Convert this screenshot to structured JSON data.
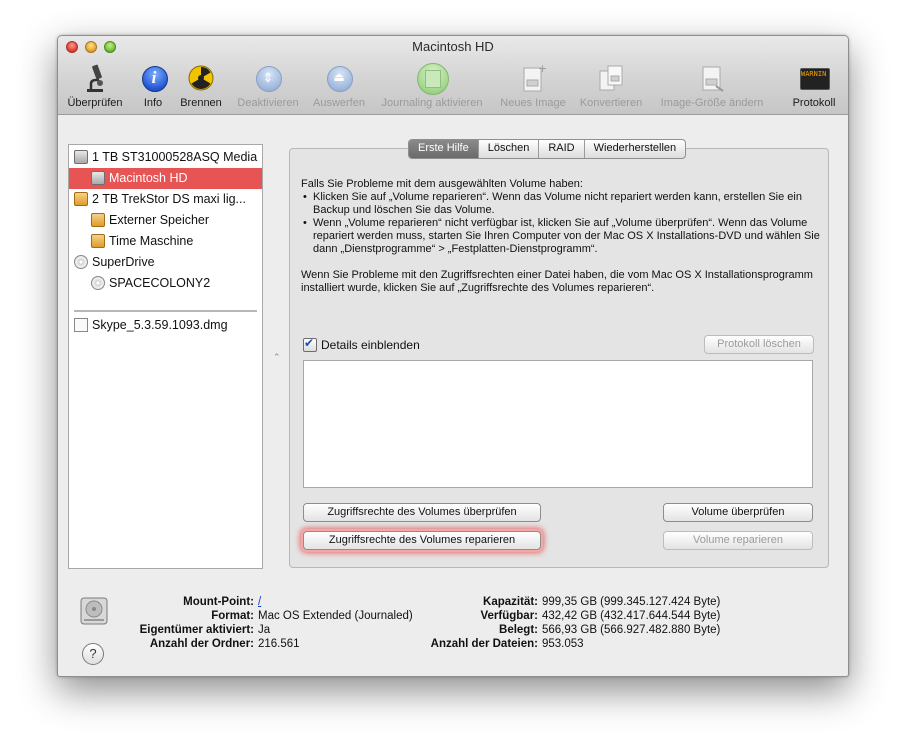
{
  "window": {
    "title": "Macintosh HD"
  },
  "toolbar": {
    "items": [
      {
        "label": "Überprüfen",
        "enabled": true,
        "icon": "microscope-icon"
      },
      {
        "label": "Info",
        "enabled": true,
        "icon": "info-icon"
      },
      {
        "label": "Brennen",
        "enabled": true,
        "icon": "burn-icon"
      },
      {
        "label": "Deaktivieren",
        "enabled": false,
        "icon": "unmount-icon"
      },
      {
        "label": "Auswerfen",
        "enabled": false,
        "icon": "eject-icon"
      },
      {
        "label": "Journaling aktivieren",
        "enabled": false,
        "icon": "journaling-icon"
      },
      {
        "label": "Neues Image",
        "enabled": false,
        "icon": "new-image-icon"
      },
      {
        "label": "Konvertieren",
        "enabled": false,
        "icon": "convert-icon"
      },
      {
        "label": "Image-Größe ändern",
        "enabled": false,
        "icon": "resize-image-icon"
      },
      {
        "label": "Protokoll",
        "enabled": true,
        "icon": "log-icon",
        "icon_text": "WARNIN AY 7:36"
      }
    ]
  },
  "sidebar": {
    "items": [
      {
        "label": "1 TB ST31000528ASQ Media",
        "icon": "hard-disk-icon",
        "selected": false
      },
      {
        "label": "Macintosh HD",
        "icon": "hard-disk-icon",
        "selected": true
      },
      {
        "label": "2 TB TrekStor DS maxi lig...",
        "icon": "external-disk-icon",
        "selected": false
      },
      {
        "label": "Externer Speicher",
        "icon": "external-volume-icon",
        "selected": false
      },
      {
        "label": "Time Maschine",
        "icon": "external-volume-icon",
        "selected": false
      },
      {
        "label": "SuperDrive",
        "icon": "optical-drive-icon",
        "selected": false
      },
      {
        "label": "SPACECOLONY2",
        "icon": "disc-icon",
        "selected": false
      },
      {
        "label": "Skype_5.3.59.1093.dmg",
        "icon": "disk-image-icon",
        "selected": false
      }
    ]
  },
  "tabs": [
    {
      "label": "Erste Hilfe",
      "active": true
    },
    {
      "label": "Löschen",
      "active": false
    },
    {
      "label": "RAID",
      "active": false
    },
    {
      "label": "Wiederherstellen",
      "active": false
    }
  ],
  "first_aid": {
    "intro": "Falls Sie Probleme mit dem ausgewählten Volume haben:",
    "bullet1": "Klicken Sie auf „Volume reparieren“. Wenn das Volume nicht repariert werden kann, erstellen Sie ein Backup und löschen Sie das Volume.",
    "bullet2": "Wenn „Volume reparieren“ nicht verfügbar ist, klicken Sie auf „Volume überprüfen“. Wenn das Volume repariert werden muss, starten Sie Ihren Computer von der Mac OS X Installations-DVD und wählen Sie dann „Dienstprogramme“ > „Festplatten-Dienstprogramm“.",
    "permissions_text": "Wenn Sie Probleme mit den Zugriffsrechten einer Datei haben, die vom Mac OS X Installationsprogramm installiert wurde, klicken Sie auf „Zugriffsrechte des Volumes reparieren“.",
    "details_label": "Details einblenden",
    "details_checked": true,
    "clear_log_label": "Protokoll löschen",
    "verify_permissions_label": "Zugriffsrechte des Volumes überprüfen",
    "repair_permissions_label": "Zugriffsrechte des Volumes reparieren",
    "verify_volume_label": "Volume überprüfen",
    "repair_volume_label": "Volume reparieren"
  },
  "info": {
    "mount_point_label": "Mount-Point:",
    "mount_point_value": "/",
    "format_label": "Format:",
    "format_value": "Mac OS Extended (Journaled)",
    "owners_label": "Eigentümer aktiviert:",
    "owners_value": "Ja",
    "folders_label": "Anzahl der Ordner:",
    "folders_value": "216.561",
    "capacity_label": "Kapazität:",
    "capacity_value": "999,35 GB (999.345.127.424 Byte)",
    "available_label": "Verfügbar:",
    "available_value": "432,42 GB (432.417.644.544 Byte)",
    "used_label": "Belegt:",
    "used_value": "566,93 GB (566.927.482.880 Byte)",
    "files_label": "Anzahl der Dateien:",
    "files_value": "953.053"
  },
  "help": {
    "label": "?"
  }
}
